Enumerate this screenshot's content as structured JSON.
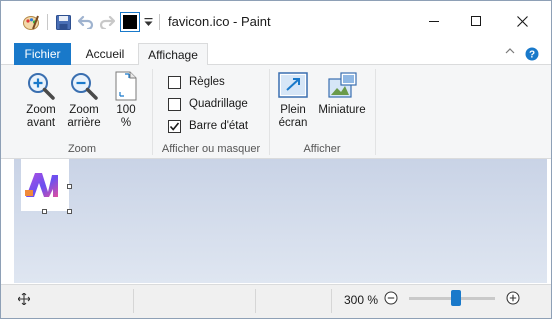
{
  "window": {
    "title": "favicon.ico - Paint"
  },
  "quick_access": {
    "icons": [
      "paint-icon",
      "save-icon",
      "undo-icon",
      "redo-icon",
      "color-swatch-icon",
      "customize-dropdown-icon"
    ],
    "current_color": "#000000"
  },
  "ribbon": {
    "tabs": {
      "file": "Fichier",
      "home": "Accueil",
      "view": "Affichage"
    },
    "active_tab": "Affichage",
    "groups": {
      "zoom": {
        "label": "Zoom",
        "zoom_in": "Zoom\navant",
        "zoom_in_l1": "Zoom",
        "zoom_in_l2": "avant",
        "zoom_out_l1": "Zoom",
        "zoom_out_l2": "arrière",
        "actual_l1": "100",
        "actual_l2": "%"
      },
      "show_hide": {
        "label": "Afficher ou masquer",
        "rulers": "Règles",
        "rulers_checked": false,
        "gridlines": "Quadrillage",
        "gridlines_checked": false,
        "statusbar": "Barre d'état",
        "statusbar_checked": true
      },
      "display": {
        "label": "Afficher",
        "fullscreen_l1": "Plein",
        "fullscreen_l2": "écran",
        "thumbnail": "Miniature"
      }
    }
  },
  "status": {
    "zoom_level": "300 %",
    "zoom_fraction": 0.55
  },
  "colors": {
    "accent": "#1979ca",
    "ribbon_bg": "#f5f6f7",
    "canvas_top": "#c9d3e6",
    "canvas_bottom": "#dfe6f1"
  }
}
